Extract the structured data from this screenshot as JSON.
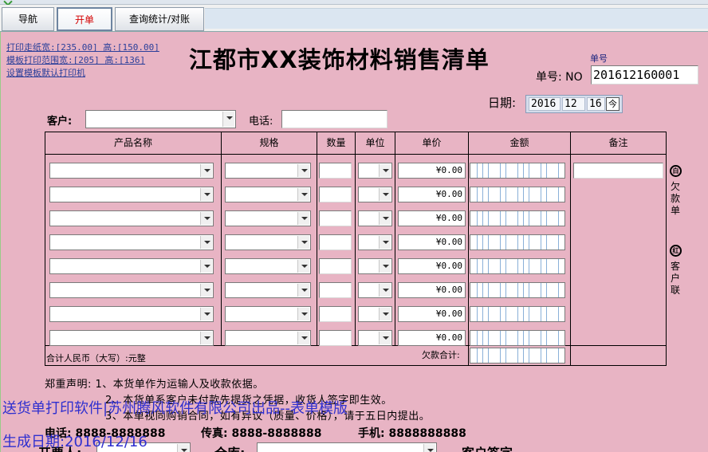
{
  "tabs": [
    {
      "label": "导航",
      "active": false
    },
    {
      "label": "开单",
      "active": true
    },
    {
      "label": "查询统计/对账",
      "active": false
    }
  ],
  "print_links": [
    "打印走纸宽:[235.00] 高:[150.00]",
    "模板打印范围宽:[205] 高:[136]",
    "设置模板默认打印机"
  ],
  "title": "江都市XX装饰材料销售清单",
  "order": {
    "caption": "单号",
    "label": "单号: NO",
    "value": "201612160001"
  },
  "date": {
    "label": "日期:",
    "year": "2016",
    "month": "12",
    "day": "16",
    "calendar_glyph": "今"
  },
  "customer": {
    "label": "客户:",
    "value": ""
  },
  "phone": {
    "label": "电话:",
    "value": ""
  },
  "table": {
    "headers": [
      "产品名称",
      "规格",
      "数量",
      "单位",
      "单价",
      "金额",
      "备注"
    ],
    "rows": [
      {
        "product": "",
        "spec": "",
        "qty": "",
        "unit": "",
        "price": "¥0.00"
      },
      {
        "product": "",
        "spec": "",
        "qty": "",
        "unit": "",
        "price": "¥0.00"
      },
      {
        "product": "",
        "spec": "",
        "qty": "",
        "unit": "",
        "price": "¥0.00"
      },
      {
        "product": "",
        "spec": "",
        "qty": "",
        "unit": "",
        "price": "¥0.00"
      },
      {
        "product": "",
        "spec": "",
        "qty": "",
        "unit": "",
        "price": "¥0.00"
      },
      {
        "product": "",
        "spec": "",
        "qty": "",
        "unit": "",
        "price": "¥0.00"
      },
      {
        "product": "",
        "spec": "",
        "qty": "",
        "unit": "",
        "price": "¥0.00"
      },
      {
        "product": "",
        "spec": "",
        "qty": "",
        "unit": "",
        "price": "¥0.00"
      }
    ],
    "total_rmb": "合计人民币（大写）:元整",
    "debt_total": "欠款合计:"
  },
  "side": {
    "debt_icon": "白",
    "debt_text": [
      "欠",
      "款",
      "单"
    ],
    "customer_icon": "红",
    "customer_text": [
      "客",
      "户",
      "联"
    ]
  },
  "notice": [
    "郑重声明: 1、本货单作为运输人及收款依据。",
    "2、本货单系客户未付款先提货之凭据，收货人签字即生效。",
    "3、本单视同购销合同，如有异议（质量、价格），请于五日内提出。"
  ],
  "contacts": {
    "phone": "电话: 8888-8888888",
    "fax": "传真: 8888-8888888",
    "mobile": "手机: 8888888888"
  },
  "bottom": {
    "issuer": "开票人:",
    "warehouse": "仓库:",
    "signature": "客户签字"
  },
  "overlay": {
    "line1": "送货单打印软件|苏州腾风软件有限公司出品--表单模版",
    "line2": "生成日期:2016/12/16"
  }
}
